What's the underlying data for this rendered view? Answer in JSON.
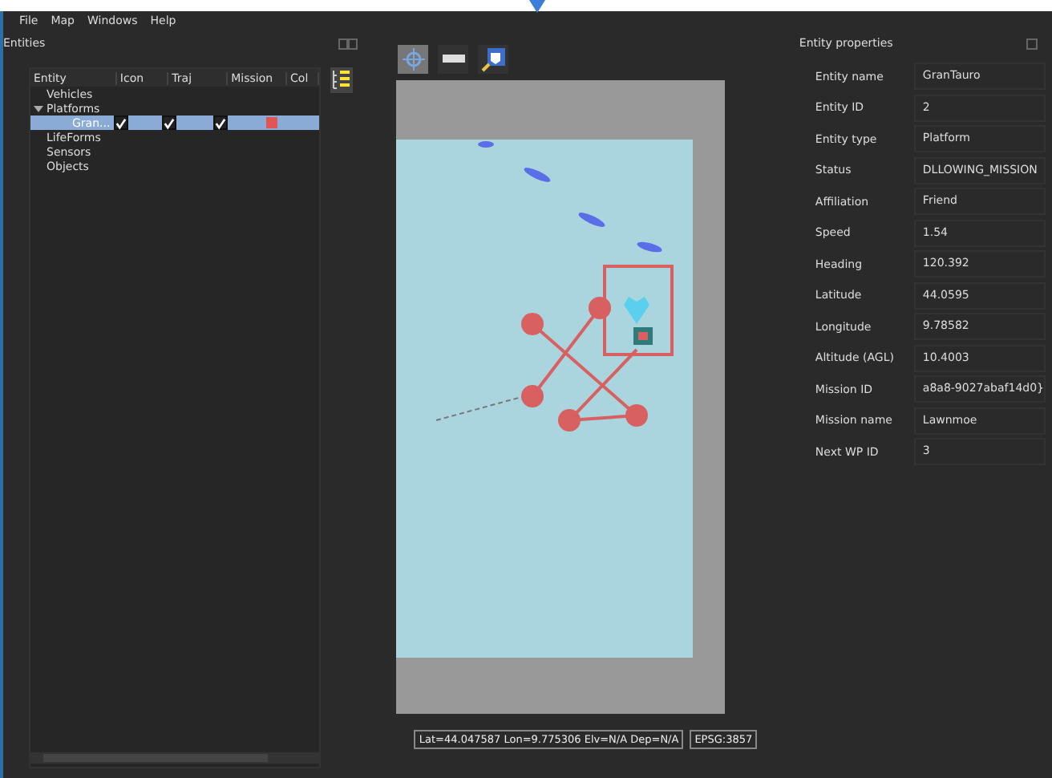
{
  "menu": [
    "File",
    "Map",
    "Windows",
    "Help"
  ],
  "entities_panel": {
    "title": "Entities",
    "columns": [
      "Entity",
      "Icon",
      "Traj",
      "Mission",
      "Col"
    ],
    "tree": [
      {
        "label": "Vehicles"
      },
      {
        "label": "Platforms",
        "expanded": true,
        "children": [
          {
            "label": "Gran...",
            "selected": true,
            "icon": true,
            "traj": true,
            "mission": true,
            "color": "#e05555"
          }
        ]
      },
      {
        "label": "LifeForms"
      },
      {
        "label": "Sensors"
      },
      {
        "label": "Objects"
      }
    ]
  },
  "map_toolbar": [
    {
      "kind": "pan",
      "selected": true
    },
    {
      "kind": "ruler",
      "selected": false
    },
    {
      "kind": "marker",
      "selected": false
    }
  ],
  "status_bar": {
    "coordinates": "Lat=44.047587 Lon=9.775306 Elv=N/A Dep=N/A",
    "projection": "EPSG:3857"
  },
  "properties_panel": {
    "title": "Entity properties",
    "rows": [
      {
        "label": "Entity name",
        "value": "GranTauro"
      },
      {
        "label": "Entity ID",
        "value": "2"
      },
      {
        "label": "Entity type",
        "value": "Platform"
      },
      {
        "label": "Status",
        "value": "DLLOWING_MISSION"
      },
      {
        "label": "Affiliation",
        "value": "Friend"
      },
      {
        "label": "Speed",
        "value": "1.54"
      },
      {
        "label": "Heading",
        "value": "120.392"
      },
      {
        "label": "Latitude",
        "value": "44.0595"
      },
      {
        "label": "Longitude",
        "value": "9.78582"
      },
      {
        "label": "Altitude (AGL)",
        "value": "10.4003"
      },
      {
        "label": "Mission ID",
        "value": "a8a8-9027abaf14d0}"
      },
      {
        "label": "Mission name",
        "value": "Lawnmoe"
      },
      {
        "label": "Next WP ID",
        "value": "3"
      }
    ]
  }
}
